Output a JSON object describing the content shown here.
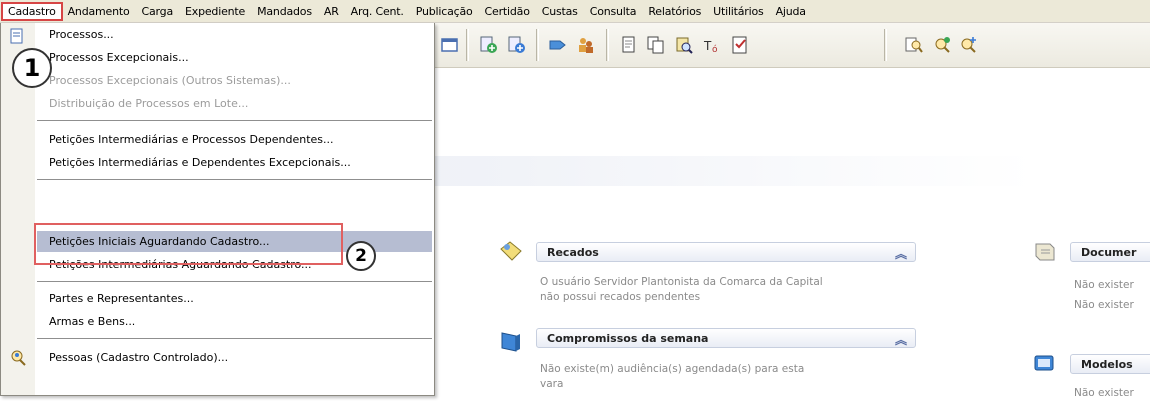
{
  "menubar": {
    "items": [
      "Cadastro",
      "Andamento",
      "Carga",
      "Expediente",
      "Mandados",
      "AR",
      "Arq. Cent.",
      "Publicação",
      "Certidão",
      "Custas",
      "Consulta",
      "Relatórios",
      "Utilitários",
      "Ajuda"
    ],
    "active": "Cadastro"
  },
  "toolbar": {
    "icons": [
      "window-icon",
      "add-green-icon",
      "add-blue-icon",
      "forward-icon",
      "people-icon",
      "document-icon",
      "copy-icon",
      "find-doc-icon",
      "tag-icon",
      "checklist-icon",
      "search-doc-icon",
      "search-add-icon",
      "search-plus-icon"
    ]
  },
  "dropdown": {
    "items": [
      {
        "label": "Processos...",
        "disabled": false
      },
      {
        "label": "Processos Excepcionais...",
        "disabled": false
      },
      {
        "label": "Processos Excepcionais (Outros Sistemas)...",
        "disabled": true
      },
      {
        "label": "Distribuição de Processos em Lote...",
        "disabled": true
      },
      {
        "label": "Petições Intermediárias e Processos Dependentes...",
        "disabled": false
      },
      {
        "label": "Petições Intermediárias e Dependentes Excepcionais...",
        "disabled": false
      },
      {
        "label": "Petições Iniciais Aguardando Cadastro...",
        "disabled": false,
        "highlighted": true
      },
      {
        "label": "Petições Intermediárias Aguardando Cadastro...",
        "disabled": false
      },
      {
        "label": "Partes e Representantes...",
        "disabled": false
      },
      {
        "label": "Armas e Bens...",
        "disabled": false
      },
      {
        "label": "Pessoas (Cadastro Controlado)...",
        "disabled": false
      }
    ]
  },
  "annotations": {
    "step1": "1",
    "step2": "2"
  },
  "widgets": {
    "recados": {
      "title": "Recados",
      "line1": "O usuário Servidor Plantonista da Comarca da Capital",
      "line2": "não possui recados pendentes"
    },
    "compromissos": {
      "title": "Compromissos da semana",
      "line1": "Não existe(m) audiência(s) agendada(s) para esta",
      "line2": "vara"
    },
    "documentos": {
      "title": "Documer",
      "line1": "Não exister",
      "line2": "Não exister"
    },
    "modelos": {
      "title": "Modelos",
      "line1": "Não exister"
    }
  },
  "colors": {
    "menubar_bg": "#ece9d8",
    "highlight_bg": "#b6bdd2",
    "annotation_red": "#e06060",
    "widget_chevron": "#5a6fa4"
  }
}
